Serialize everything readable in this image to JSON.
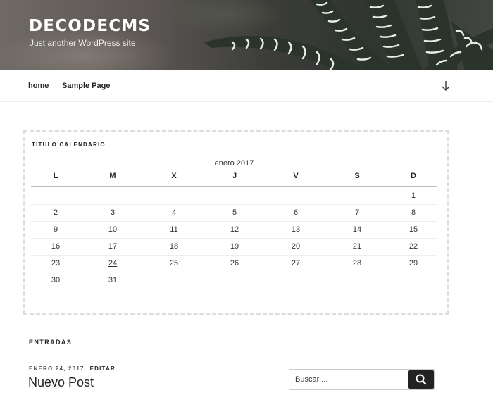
{
  "header": {
    "site_title": "DECODECMS",
    "site_description": "Just another WordPress site"
  },
  "nav": {
    "items": [
      {
        "label": "home"
      },
      {
        "label": "Sample Page"
      }
    ],
    "scroll_icon": "arrow-down-icon"
  },
  "calendar": {
    "widget_title": "TITULO CALENDARIO",
    "caption": "enero 2017",
    "weekdays": [
      "L",
      "M",
      "X",
      "J",
      "V",
      "S",
      "D"
    ],
    "weeks": [
      [
        "",
        "",
        "",
        "",
        "",
        "",
        "1"
      ],
      [
        "2",
        "3",
        "4",
        "5",
        "6",
        "7",
        "8"
      ],
      [
        "9",
        "10",
        "11",
        "12",
        "13",
        "14",
        "15"
      ],
      [
        "16",
        "17",
        "18",
        "19",
        "20",
        "21",
        "22"
      ],
      [
        "23",
        "24",
        "25",
        "26",
        "27",
        "28",
        "29"
      ],
      [
        "30",
        "31",
        "",
        "",
        "",
        "",
        ""
      ]
    ],
    "linked_days": [
      "1",
      "24"
    ]
  },
  "posts": {
    "section_title": "ENTRADAS",
    "items": [
      {
        "date": "ENERO 24, 2017",
        "edit_label": "EDITAR",
        "title": "Nuevo Post"
      }
    ]
  },
  "search": {
    "placeholder": "Buscar ...",
    "button_icon": "search-icon"
  },
  "colors": {
    "text": "#222222",
    "border_dashed": "#dddddd",
    "button_bg": "#222222"
  }
}
